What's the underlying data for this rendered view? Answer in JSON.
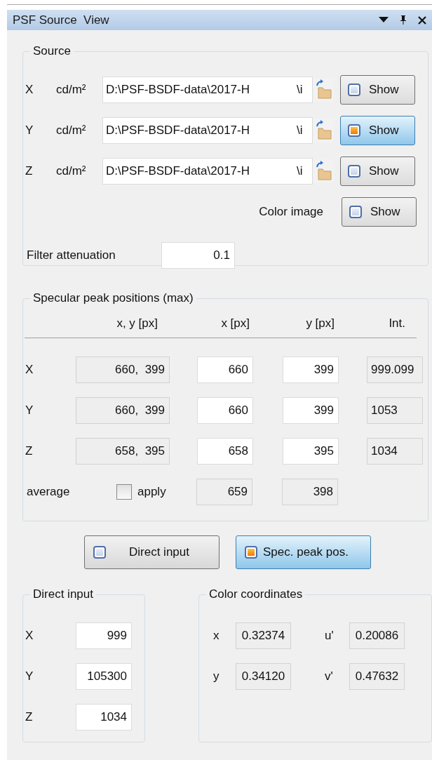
{
  "window": {
    "title": "PSF Source  View"
  },
  "source": {
    "title": "Source",
    "rows": [
      {
        "label": "X",
        "unit": "cd/m²",
        "path": "D:\\PSF-BSDF-data\\2017-H",
        "path_tail": "\\i",
        "show": {
          "label": "Show",
          "selected": false
        }
      },
      {
        "label": "Y",
        "unit": "cd/m²",
        "path": "D:\\PSF-BSDF-data\\2017-H",
        "path_tail": "\\i",
        "show": {
          "label": "Show",
          "selected": true
        }
      },
      {
        "label": "Z",
        "unit": "cd/m²",
        "path": "D:\\PSF-BSDF-data\\2017-H",
        "path_tail": "\\i",
        "show": {
          "label": "Show",
          "selected": false
        }
      }
    ],
    "color_image": {
      "label": "Color image",
      "show": {
        "label": "Show",
        "selected": false
      }
    },
    "filter": {
      "label": "Filter attenuation",
      "value": "0.1"
    }
  },
  "specular": {
    "title": "Specular peak positions (max)",
    "columns": [
      "x, y [px]",
      "x [px]",
      "y [px]",
      "Int."
    ],
    "rows": [
      {
        "label": "X",
        "cells": [
          {
            "value": "660,  399",
            "readonly": true
          },
          {
            "value": "660",
            "readonly": false
          },
          {
            "value": "399",
            "readonly": false
          },
          {
            "value": "999.099",
            "readonly": true
          }
        ]
      },
      {
        "label": "Y",
        "cells": [
          {
            "value": "660,  399",
            "readonly": true
          },
          {
            "value": "660",
            "readonly": false
          },
          {
            "value": "399",
            "readonly": false
          },
          {
            "value": "1053",
            "readonly": true
          }
        ]
      },
      {
        "label": "Z",
        "cells": [
          {
            "value": "658,  395",
            "readonly": true
          },
          {
            "value": "658",
            "readonly": false
          },
          {
            "value": "395",
            "readonly": false
          },
          {
            "value": "1034",
            "readonly": true
          }
        ]
      }
    ],
    "average": {
      "label": "average",
      "apply": {
        "label": "apply",
        "checked": false
      },
      "cells": [
        {
          "value": "659",
          "readonly": true
        },
        {
          "value": "398",
          "readonly": true
        }
      ]
    }
  },
  "modes": [
    {
      "label": "Direct input",
      "selected": false
    },
    {
      "label": "Spec. peak pos.",
      "selected": true
    }
  ],
  "direct_input": {
    "title": "Direct input",
    "rows": [
      {
        "label": "X",
        "value": "999"
      },
      {
        "label": "Y",
        "value": "105300"
      },
      {
        "label": "Z",
        "value": "1034"
      }
    ]
  },
  "color_coordinates": {
    "title": "Color coordinates",
    "rows": [
      [
        {
          "label": "x",
          "value": "0.32374"
        },
        {
          "label": "u'",
          "value": "0.20086"
        }
      ],
      [
        {
          "label": "y",
          "value": "0.34120"
        },
        {
          "label": "v'",
          "value": "0.47632"
        }
      ]
    ]
  }
}
